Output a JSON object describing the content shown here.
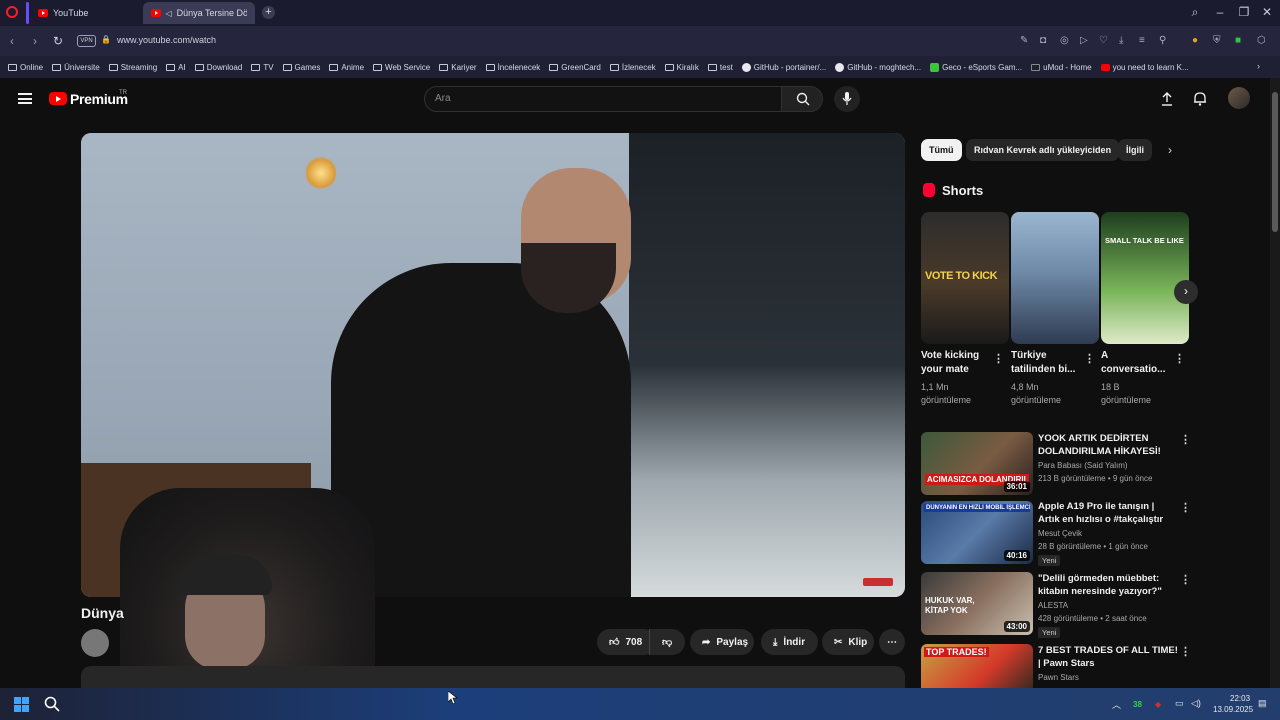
{
  "browser": {
    "tabs": [
      {
        "label": "YouTube"
      },
      {
        "label": "Dünya Tersine Dönse"
      }
    ],
    "url": "www.youtube.com/watch",
    "vpn_label": "VPN"
  },
  "bookmarks": [
    {
      "label": "Online",
      "icon": "folder-icon"
    },
    {
      "label": "Üniversite",
      "icon": "folder-icon"
    },
    {
      "label": "Streaming",
      "icon": "folder-icon"
    },
    {
      "label": "AI",
      "icon": "folder-icon"
    },
    {
      "label": "Download",
      "icon": "folder-icon"
    },
    {
      "label": "TV",
      "icon": "folder-icon"
    },
    {
      "label": "Games",
      "icon": "folder-icon"
    },
    {
      "label": "Anime",
      "icon": "folder-icon"
    },
    {
      "label": "Web Service",
      "icon": "folder-icon"
    },
    {
      "label": "Kariyer",
      "icon": "folder-icon"
    },
    {
      "label": "İncelenecek",
      "icon": "folder-icon"
    },
    {
      "label": "GreenCard",
      "icon": "folder-icon"
    },
    {
      "label": "İzlenecek",
      "icon": "folder-icon"
    },
    {
      "label": "Kiralık",
      "icon": "folder-icon"
    },
    {
      "label": "test",
      "icon": "folder-icon"
    },
    {
      "label": "GitHub - portainer/...",
      "icon": "github-icon"
    },
    {
      "label": "GitHub - moghtech...",
      "icon": "github-icon"
    },
    {
      "label": "Geco - eSports Gam...",
      "icon": "geco-icon"
    },
    {
      "label": "uMod - Home",
      "icon": "umod-icon"
    },
    {
      "label": "you need to learn K...",
      "icon": "youtube-icon"
    }
  ],
  "youtube": {
    "brand": "Premium",
    "region": "TR",
    "search_placeholder": "Ara"
  },
  "video": {
    "title": "Dünya",
    "likes": "708",
    "share_label": "Paylaş",
    "download_label": "İndir",
    "clip_label": "Klip"
  },
  "chips": [
    "Tümü",
    "Rıdvan Kevrek adlı yükleyiciden",
    "İlgili"
  ],
  "shorts": {
    "heading": "Shorts",
    "items": [
      {
        "title": "Vote kicking your mate",
        "views": "1,1 Mn görüntüleme",
        "thumb_text": "VOTE TO KICK"
      },
      {
        "title": "Türkiye tatilinden bi...",
        "views": "4,8 Mn görüntüleme",
        "thumb_text": ""
      },
      {
        "title": "A conversatio...",
        "views": "18 B görüntüleme",
        "thumb_text": "SMALL TALK BE LIKE"
      }
    ]
  },
  "recommended": [
    {
      "title": "YOOK ARTIK DEDİRTEN DOLANDIRILMA HİKAYESİ!",
      "channel": "Para Babası (Said Yalım)",
      "meta": "213 B görüntüleme • 9 gün önce",
      "duration": "36:01",
      "thumb_text": "ACIMASIZCA DOLANDIRILDI",
      "badge": ""
    },
    {
      "title": "Apple A19 Pro ile tanışın | Artık en hızlısı o #takçalıştır",
      "channel": "Mesut Çevik",
      "meta": "28 B görüntüleme • 1 gün önce",
      "duration": "40:16",
      "thumb_text": "DÜNYANIN EN HIZLI MOBİL İŞLEMCİSİ",
      "badge": "Yeni"
    },
    {
      "title": "\"Delili görmeden müebbet: kitabın neresinde yazıyor?\"",
      "channel": "ALESTA",
      "meta": "428 görüntüleme • 2 saat önce",
      "duration": "43:00",
      "thumb_text": "HUKUK VAR, KİTAP YOK",
      "badge": "Yeni"
    },
    {
      "title": "7 BEST TRADES OF ALL TIME! | Pawn Stars",
      "channel": "Pawn Stars",
      "meta": "",
      "duration": "",
      "thumb_text": "TOP TRADES!",
      "badge": ""
    }
  ],
  "taskbar": {
    "tray_number": "38",
    "time": "22:03",
    "date": "13.09.2025"
  }
}
